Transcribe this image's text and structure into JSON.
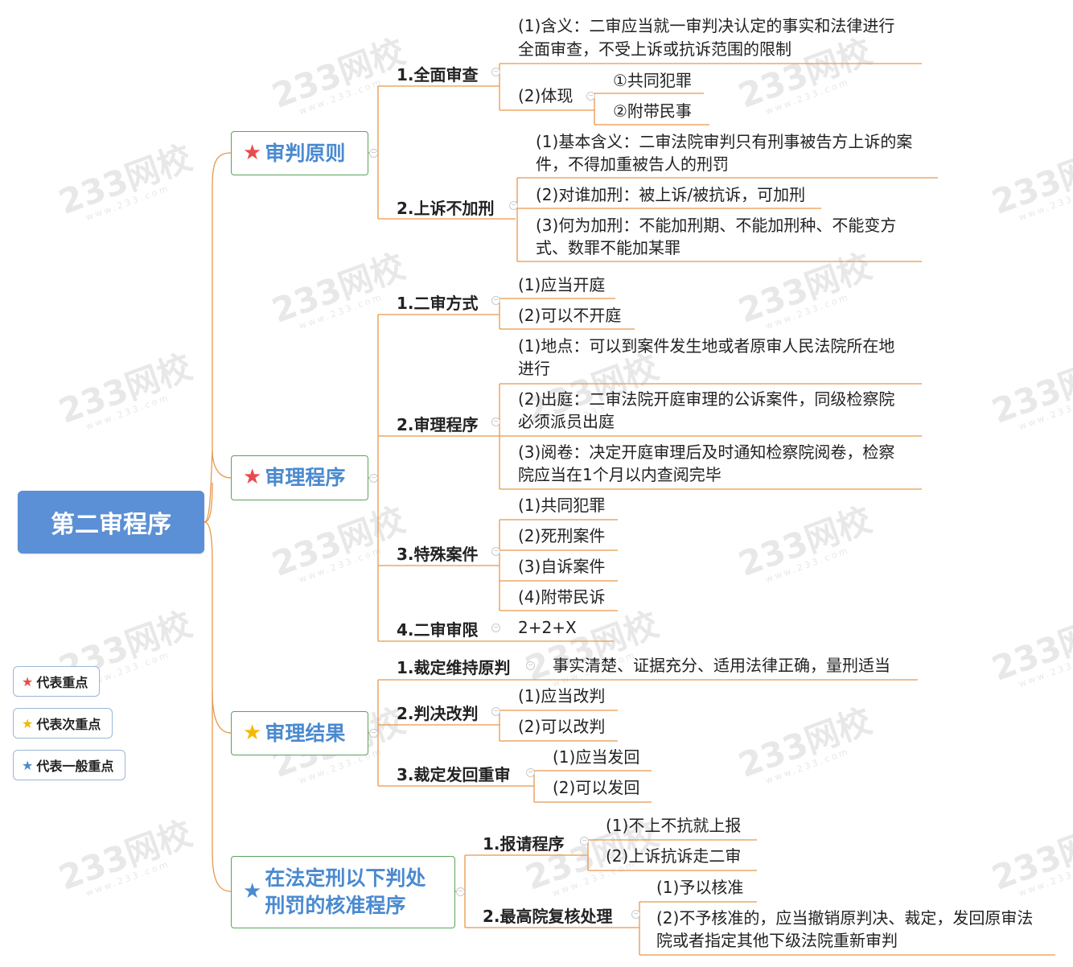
{
  "root": {
    "title": "第二审程序"
  },
  "colors": {
    "line": "#e8974b",
    "root_bg": "#5b8fd6",
    "node_border": "#5ba35b",
    "node_text": "#4a8ad0",
    "star_key": "#e84b4b",
    "star_secondary": "#f5b800",
    "star_general": "#4a8ad0"
  },
  "watermark": {
    "text": "233网校",
    "sub": "www.233.com"
  },
  "branches": [
    {
      "title": "审判原则",
      "star": "★",
      "subs": [
        {
          "title": "1.全面审查",
          "leaves": [
            "(1)含义：二审应当就一审判决认定的事实和法律进行",
            "全面审查，不受上诉或抗诉范围的限制",
            "(2)体现"
          ],
          "deep": [
            "①共同犯罪",
            "②附带民事"
          ]
        },
        {
          "title": "2.上诉不加刑",
          "leaves": [
            "(1)基本含义：二审法院审判只有刑事被告方上诉的案",
            "件，不得加重被告人的刑罚",
            "(2)对谁加刑：被上诉/被抗诉，可加刑",
            "(3)何为加刑：不能加刑期、不能加刑种、不能变方",
            "式、数罪不能加某罪"
          ]
        }
      ]
    },
    {
      "title": "审理程序",
      "star": "★",
      "subs": [
        {
          "title": "1.二审方式",
          "leaves": [
            "(1)应当开庭",
            "(2)可以不开庭"
          ]
        },
        {
          "title": "2.审理程序",
          "leaves": [
            "(1)地点：可以到案件发生地或者原审人民法院所在地",
            "进行",
            "(2)出庭：二审法院开庭审理的公诉案件，同级检察院",
            "必须派员出庭",
            "(3)阅卷：决定开庭审理后及时通知检察院阅卷，检察",
            "院应当在1个月以内查阅完毕"
          ]
        },
        {
          "title": "3.特殊案件",
          "leaves": [
            "(1)共同犯罪",
            "(2)死刑案件",
            "(3)自诉案件",
            "(4)附带民诉"
          ]
        },
        {
          "title": "4.二审审限",
          "leaves": [
            "2+2+X"
          ]
        }
      ]
    },
    {
      "title": "审理结果",
      "star": "★",
      "subs": [
        {
          "title": "1.裁定维持原判",
          "leaves": [
            "事实清楚、证据充分、适用法律正确，量刑适当"
          ]
        },
        {
          "title": "2.判决改判",
          "leaves": [
            "(1)应当改判",
            "(2)可以改判"
          ]
        },
        {
          "title": "3.裁定发回重审",
          "leaves": [
            "(1)应当发回",
            "(2)可以发回"
          ]
        }
      ]
    },
    {
      "title_lines": [
        "在法定刑以下判处",
        "刑罚的核准程序"
      ],
      "star": "★",
      "subs": [
        {
          "title": "1.报请程序",
          "leaves": [
            "(1)不上不抗就上报",
            "(2)上诉抗诉走二审"
          ]
        },
        {
          "title": "2.最高院复核处理",
          "leaves": [
            "(1)予以核准",
            "(2)不予核准的，应当撤销原判决、裁定，发回原审法",
            "院或者指定其他下级法院重新审判"
          ]
        }
      ]
    }
  ],
  "legend": [
    "代表重点",
    "代表次重点",
    "代表一般重点"
  ]
}
